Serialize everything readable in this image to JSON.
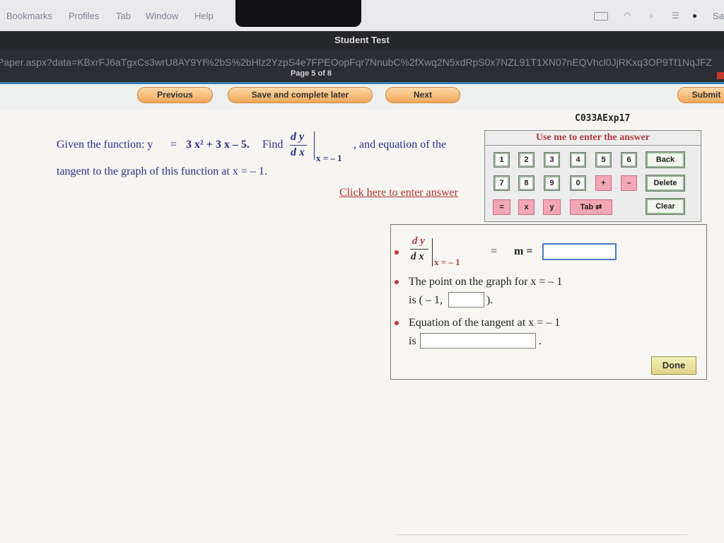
{
  "menubar": {
    "items": [
      "Bookmarks",
      "Profiles",
      "Tab",
      "Window",
      "Help"
    ],
    "tray": [
      "battery-icon",
      "wifi-icon",
      "search-icon",
      "control-center-icon",
      "siri-icon"
    ],
    "clock_fragment": "Sa"
  },
  "window": {
    "title": "Student Test",
    "url": "Paper.aspx?data=KBxrFJ6aTgxCs3wrU8AY9Yf%2bS%2bHlz2YzpS4e7FPEOopFqr7NnubC%2fXwq2N5xdRpS0x7NZL91T1XN07nEQVhcl0JjRKxq3OP9Tf1NqJFZ",
    "page_indicator": "Page 5 of 8"
  },
  "nav": {
    "previous": "Previous",
    "save_later": "Save and complete later",
    "next": "Next",
    "submit": "Submit"
  },
  "question": {
    "id": "C033AExp17",
    "prefix": "Given the function: y",
    "equals": "=",
    "expression": "3 x² + 3 x – 5.",
    "find": "Find",
    "dy": "d y",
    "dx": "d x",
    "at_x": "x  =  – 1",
    "comma": ",",
    "suffix": "and equation of the",
    "line2": "tangent to the graph of this function at x  =  – 1.",
    "link": "Click here to enter answer"
  },
  "keypad": {
    "title": "Use me to enter the answer",
    "row1": [
      "1",
      "2",
      "3",
      "4",
      "5",
      "6"
    ],
    "row2": [
      "7",
      "8",
      "9",
      "0",
      "+",
      "–"
    ],
    "row3": [
      "=",
      "x",
      "y",
      "Tab ⇄"
    ],
    "back": "Back",
    "delete": "Delete",
    "clear": "Clear"
  },
  "answers": {
    "slope_dy": "d y",
    "slope_dx": "d x",
    "slope_at": "x  =  – 1",
    "slope_eq": "=",
    "slope_m": "m  =",
    "point_line1": "The point on the graph for x  =  – 1",
    "point_prefix": "is ( – 1,",
    "point_suffix": ").",
    "tangent_line1": "Equation of the tangent at x  =  – 1",
    "tangent_prefix": "is",
    "tangent_suffix": ".",
    "done": "Done"
  }
}
